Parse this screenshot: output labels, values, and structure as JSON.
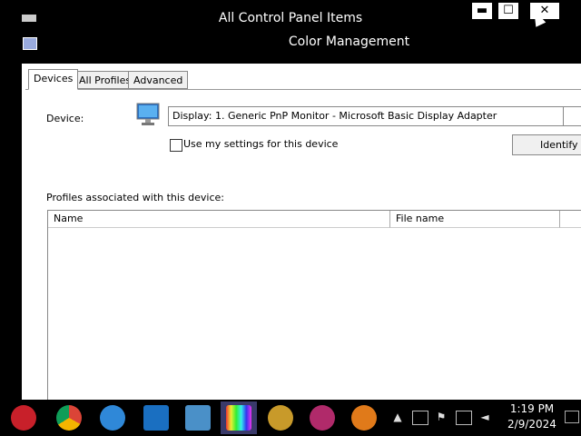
{
  "background_window": {
    "title": "All Control Panel Items",
    "minimize": "▬",
    "maximize": "☐",
    "close": "✕"
  },
  "dialog": {
    "title": "Color Management",
    "tabs": [
      {
        "label": "Devices",
        "active": true
      },
      {
        "label": "All Profiles",
        "active": false
      },
      {
        "label": "Advanced",
        "active": false
      }
    ],
    "device_label": "Device:",
    "device_value": "Display: 1. Generic PnP Monitor - Microsoft Basic Display Adapter",
    "checkbox_label": "Use my settings for this device",
    "checkbox_checked": false,
    "identify_button": "Identify monitors",
    "profiles_label": "Profiles associated with this device:",
    "columns": [
      "Name",
      "File name"
    ]
  },
  "taskbar": {
    "apps": [
      {
        "icon": "christmas-ornament-icon",
        "color": "#c8202a"
      },
      {
        "icon": "chrome-icon",
        "color": "#e8b400"
      },
      {
        "icon": "edge-icon",
        "color": "#2f88d8"
      },
      {
        "icon": "outlook-icon",
        "color": "#1a6fc1"
      },
      {
        "icon": "control-panel-icon",
        "color": "#4a90c8"
      },
      {
        "icon": "color-management-icon",
        "color": "#6a3fb0"
      },
      {
        "icon": "game-badge-icon",
        "color": "#c89a2a"
      },
      {
        "icon": "gem-icon",
        "color": "#b02a6a"
      },
      {
        "icon": "p-app-icon",
        "color": "#e07a1a"
      }
    ],
    "tray_arrow": "▲",
    "time": "1:19 PM",
    "date": "2/9/2024"
  }
}
